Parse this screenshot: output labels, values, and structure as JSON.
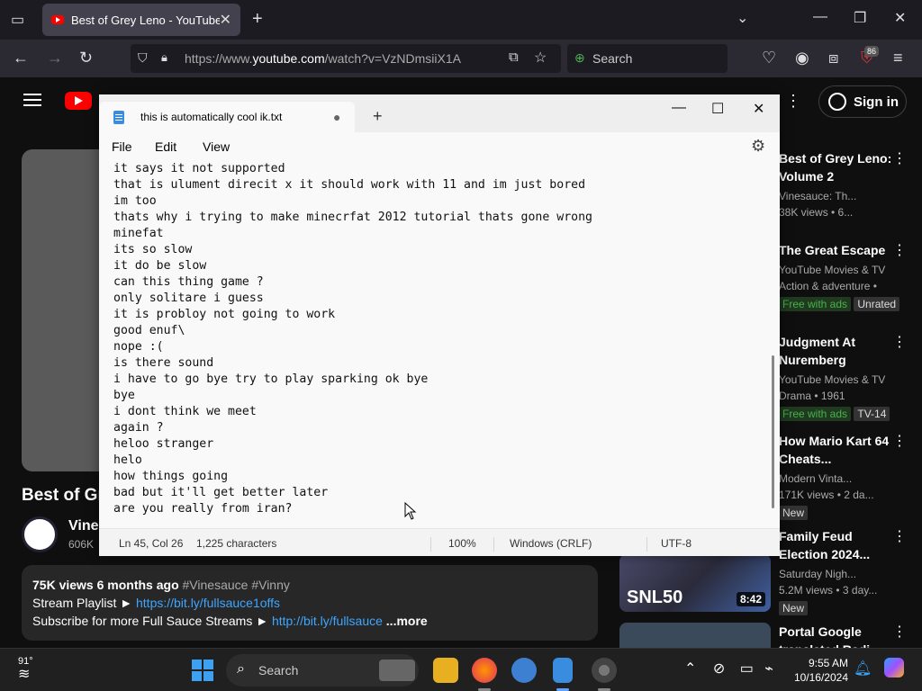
{
  "browser": {
    "tab_title": "Best of Grey Leno - YouTube",
    "url_prefix": "https://www.",
    "url_host": "youtube.com",
    "url_path": "/watch?v=VzNDmsiiX1A",
    "search_placeholder": "Search",
    "extension_badge": "86"
  },
  "youtube": {
    "sign_in_label": "Sign in",
    "video_title": "Best of Grey Leno: Volume 2",
    "channel_name": "Vinesauce",
    "channel_subs": "606K",
    "description": {
      "views": "75K views",
      "date": "6 months ago",
      "tags": "#Vinesauce #Vinny",
      "line2_label": "Stream Playlist ►",
      "line2_link": "https://bit.ly/fullsauce1offs",
      "line3_label": "Subscribe for more Full Sauce Streams ►",
      "line3_link": "http://bit.ly/fullsauce",
      "more_label": "...more"
    },
    "recommendations": [
      {
        "title": "Best of Grey Leno: Volume 2",
        "channel": "Vinesauce: Th...",
        "meta": "38K views • 6..."
      },
      {
        "title": "The Great Escape",
        "channel": "YouTube Movies & TV",
        "meta": "Action & adventure •",
        "chips": [
          "Free with ads",
          "Unrated"
        ]
      },
      {
        "title": "Judgment At Nuremberg",
        "channel": "YouTube Movies & TV",
        "meta": "Drama • 1961",
        "chips": [
          "Free with ads",
          "TV-14"
        ]
      },
      {
        "title": "How Mario Kart 64 Cheats...",
        "channel": "Modern Vinta...",
        "meta": "171K views • 2 da...",
        "chips": [
          "New"
        ]
      },
      {
        "title": "Family Feud Election 2024...",
        "channel": "Saturday Nigh...",
        "meta": "5.2M views • 3 day...",
        "chips": [
          "New"
        ],
        "thumb_label": "SNL50",
        "duration": "8:42"
      },
      {
        "title": "Portal Google translated Radi...",
        "channel": "",
        "meta": ""
      }
    ]
  },
  "notepad": {
    "tab_title": "this is automatically cool ik.txt",
    "menu": [
      "File",
      "Edit",
      "View"
    ],
    "lines": [
      "it says it not supported",
      "that is ulument direcit x it should work with 11 and im just bored",
      "im too",
      "thats why i trying to make minecrfat 2012 tutorial thats gone wrong",
      "minefat",
      "its so slow",
      "it do be slow",
      "can this thing game ?",
      "only solitare i guess",
      "it is probloy not going to work",
      "good enuf\\",
      "nope :(",
      "is there sound",
      "i have to go bye try to play sparking ok bye",
      "bye",
      "i dont think we meet",
      "again ?",
      "heloo stranger",
      "helo",
      "how things going",
      "bad but it'll get better later",
      "are you really from iran?"
    ],
    "status": {
      "position": "Ln 45, Col 26",
      "chars": "1,225 characters",
      "zoom": "100%",
      "line_ending": "Windows (CRLF)",
      "encoding": "UTF-8"
    }
  },
  "taskbar": {
    "weather": "91°",
    "search_placeholder": "Search",
    "time": "9:55 AM",
    "date": "10/16/2024"
  }
}
